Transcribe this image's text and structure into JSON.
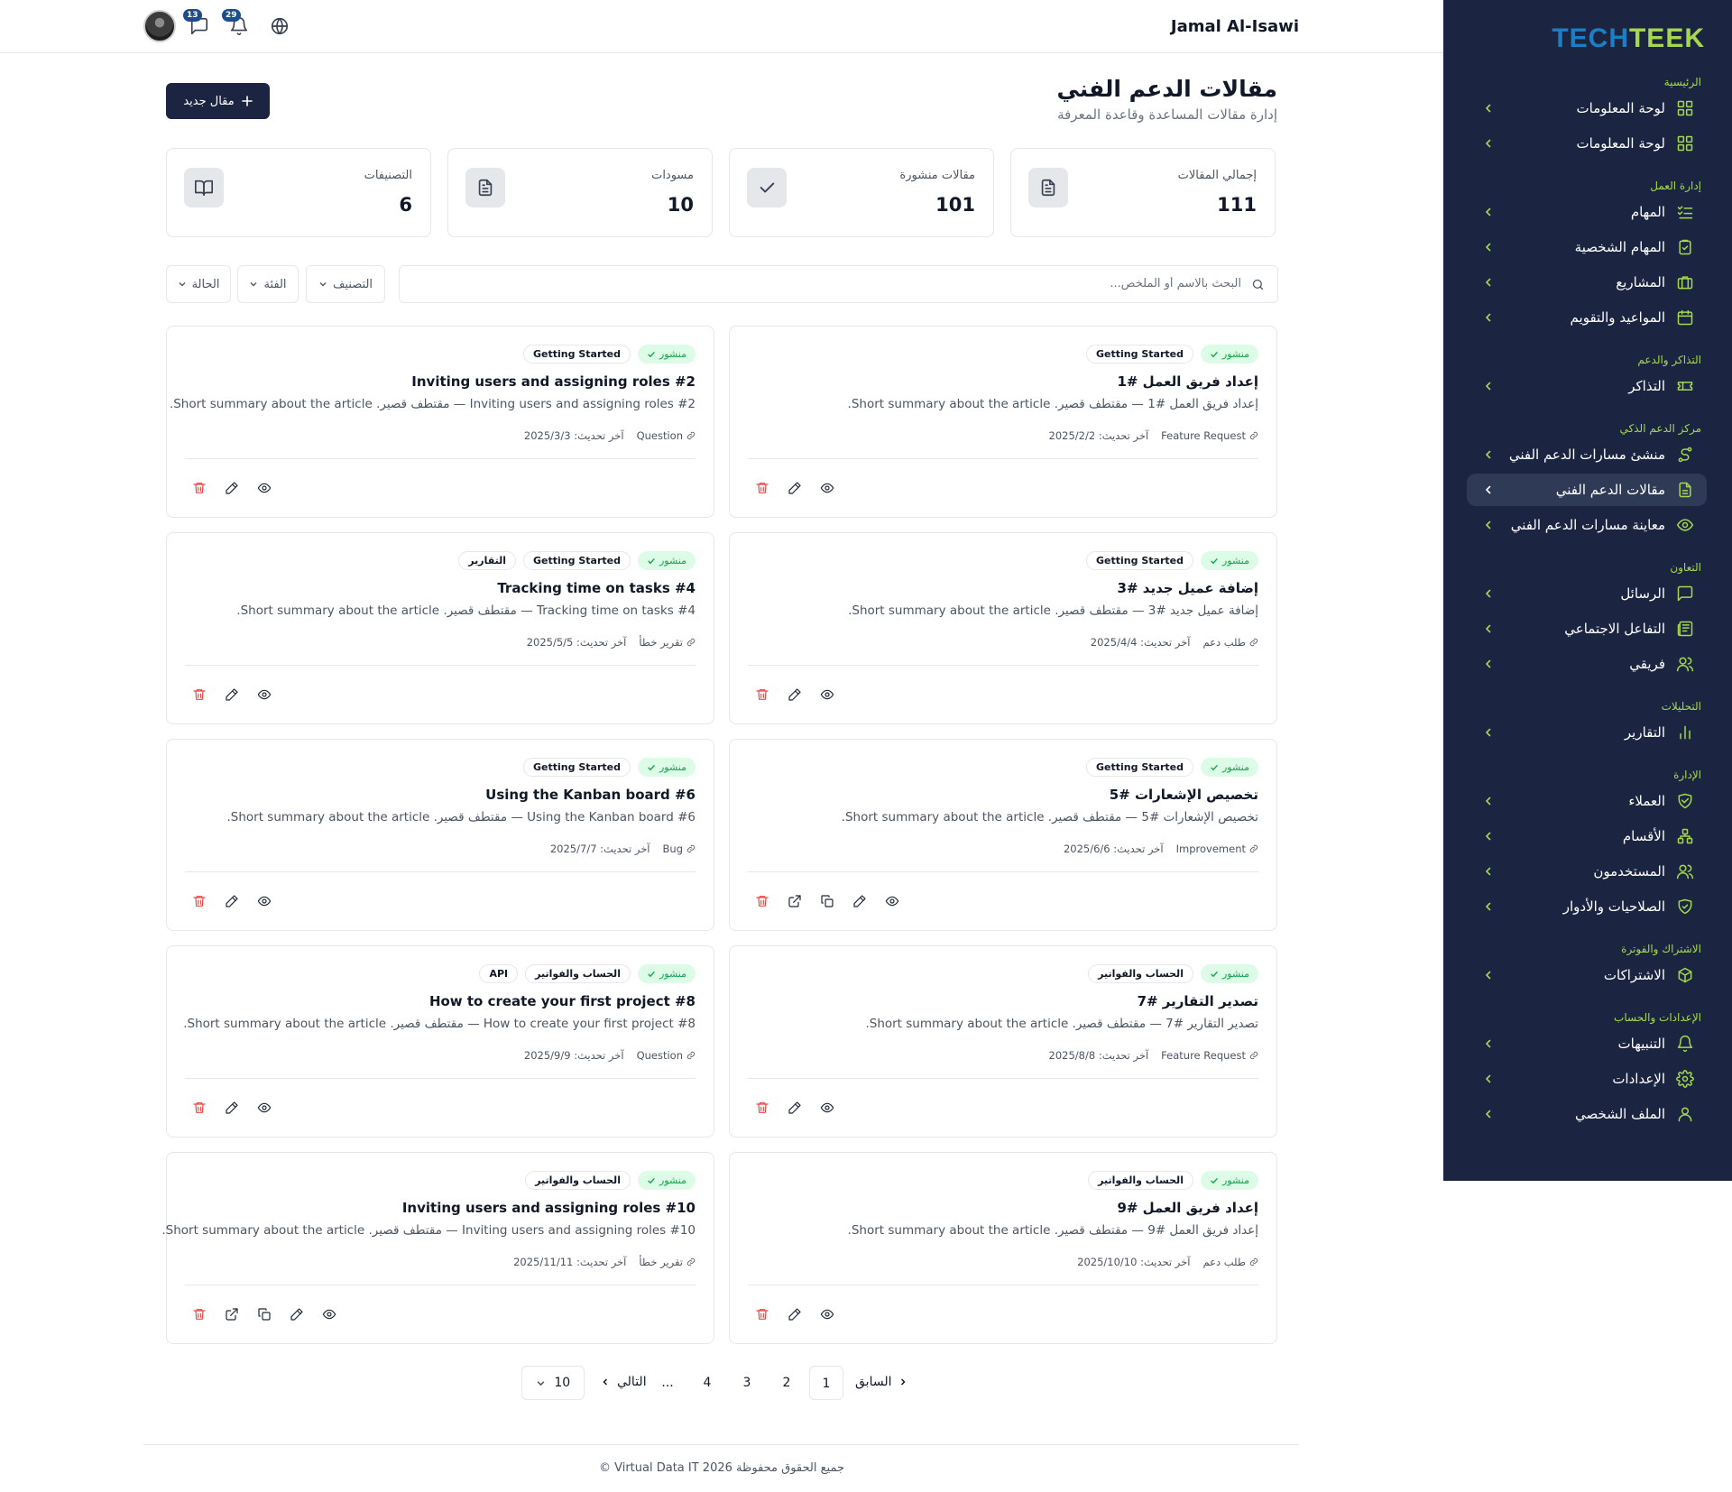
{
  "brand": {
    "part1": "TECH",
    "part2": "TEEK"
  },
  "header": {
    "user_name": "Jamal Al-Isawi",
    "messages_count": "13",
    "notifications_count": "29"
  },
  "sidebar": {
    "sections": [
      {
        "title": "الرئيسية",
        "items": [
          {
            "label": "لوحة المعلومات",
            "icon": "dashboard-icon"
          },
          {
            "label": "لوحة المعلومات",
            "icon": "dashboard-icon"
          }
        ]
      },
      {
        "title": "إدارة العمل",
        "items": [
          {
            "label": "المهام",
            "icon": "list-checks-icon"
          },
          {
            "label": "المهام الشخصية",
            "icon": "clipboard-check-icon"
          },
          {
            "label": "المشاريع",
            "icon": "briefcase-icon"
          },
          {
            "label": "المواعيد والتقويم",
            "icon": "calendar-icon"
          }
        ]
      },
      {
        "title": "التذاكر والدعم",
        "items": [
          {
            "label": "التذاكر",
            "icon": "ticket-icon"
          }
        ]
      },
      {
        "title": "مركز الدعم الذكي",
        "items": [
          {
            "label": "منشئ مسارات الدعم الفني",
            "icon": "route-icon"
          },
          {
            "label": "مقالات الدعم الفني",
            "icon": "document-icon",
            "active": true
          },
          {
            "label": "معاينة مسارات الدعم الفني",
            "icon": "eye-icon"
          }
        ]
      },
      {
        "title": "التعاون",
        "items": [
          {
            "label": "الرسائل",
            "icon": "message-icon"
          },
          {
            "label": "التفاعل الاجتماعي",
            "icon": "newspaper-icon"
          },
          {
            "label": "فريقي",
            "icon": "users-icon"
          }
        ]
      },
      {
        "title": "التحليلات",
        "items": [
          {
            "label": "التقارير",
            "icon": "bar-chart-icon"
          }
        ]
      },
      {
        "title": "الإدارة",
        "items": [
          {
            "label": "العملاء",
            "icon": "handshake-icon"
          },
          {
            "label": "الأقسام",
            "icon": "hierarchy-icon"
          },
          {
            "label": "المستخدمون",
            "icon": "users-icon"
          },
          {
            "label": "الصلاحيات والأدوار",
            "icon": "shield-check-icon"
          }
        ]
      },
      {
        "title": "الاشتراك والفوترة",
        "items": [
          {
            "label": "الاشتراكات",
            "icon": "package-icon"
          }
        ]
      },
      {
        "title": "الإعدادات والحساب",
        "items": [
          {
            "label": "التنبيهات",
            "icon": "bell-icon"
          },
          {
            "label": "الإعدادات",
            "icon": "gear-icon"
          },
          {
            "label": "الملف الشخصي",
            "icon": "user-icon"
          }
        ]
      }
    ]
  },
  "page": {
    "title": "مقالات الدعم الفني",
    "subtitle": "إدارة مقالات المساعدة وقاعدة المعرفة",
    "new_button": "مقال جديد"
  },
  "stats": [
    {
      "label": "إجمالي المقالات",
      "value": "111",
      "icon": "document-icon"
    },
    {
      "label": "مقالات منشورة",
      "value": "101",
      "icon": "check-icon"
    },
    {
      "label": "مسودات",
      "value": "10",
      "icon": "document-icon"
    },
    {
      "label": "التصنيفات",
      "value": "6",
      "icon": "book-open-icon"
    }
  ],
  "filters": {
    "search_placeholder": "البحث بالاسم أو الملخص...",
    "category": "التصنيف",
    "type": "الفئة",
    "status": "الحالة"
  },
  "updated_prefix": "آخر تحديث:",
  "cards": [
    {
      "status": "منشور",
      "tags": [
        "Getting Started"
      ],
      "title": "إعداد فريق العمل #1",
      "summary": "إعداد فريق العمل #1 — مقتطف قصير. Short summary about the article.",
      "type": "Feature Request",
      "updated": "2025/2/2",
      "extra_actions": false
    },
    {
      "status": "منشور",
      "tags": [
        "Getting Started"
      ],
      "title": "Inviting users and assigning roles #2",
      "summary": "Inviting users and assigning roles #2 — مقتطف قصير. Short summary about the article.",
      "type": "Question",
      "updated": "2025/3/3",
      "extra_actions": false
    },
    {
      "status": "منشور",
      "tags": [
        "Getting Started"
      ],
      "title": "إضافة عميل جديد #3",
      "summary": "إضافة عميل جديد #3 — مقتطف قصير. Short summary about the article.",
      "type": "طلب دعم",
      "updated": "2025/4/4",
      "extra_actions": false
    },
    {
      "status": "منشور",
      "tags": [
        "Getting Started",
        "التقارير"
      ],
      "title": "Tracking time on tasks #4",
      "summary": "Tracking time on tasks #4 — مقتطف قصير. Short summary about the article.",
      "type": "تقرير خطأ",
      "updated": "2025/5/5",
      "extra_actions": false
    },
    {
      "status": "منشور",
      "tags": [
        "Getting Started"
      ],
      "title": "تخصيص الإشعارات #5",
      "summary": "تخصيص الإشعارات #5 — مقتطف قصير. Short summary about the article.",
      "type": "Improvement",
      "updated": "2025/6/6",
      "extra_actions": true
    },
    {
      "status": "منشور",
      "tags": [
        "Getting Started"
      ],
      "title": "Using the Kanban board #6",
      "summary": "Using the Kanban board #6 — مقتطف قصير. Short summary about the article.",
      "type": "Bug",
      "updated": "2025/7/7",
      "extra_actions": false
    },
    {
      "status": "منشور",
      "tags": [
        "الحساب والفواتير"
      ],
      "title": "تصدير التقارير #7",
      "summary": "تصدير التقارير #7 — مقتطف قصير. Short summary about the article.",
      "type": "Feature Request",
      "updated": "2025/8/8",
      "extra_actions": false
    },
    {
      "status": "منشور",
      "tags": [
        "الحساب والفواتير",
        "API"
      ],
      "title": "How to create your first project #8",
      "summary": "How to create your first project #8 — مقتطف قصير. Short summary about the article.",
      "type": "Question",
      "updated": "2025/9/9",
      "extra_actions": false
    },
    {
      "status": "منشور",
      "tags": [
        "الحساب والفواتير"
      ],
      "title": "إعداد فريق العمل #9",
      "summary": "إعداد فريق العمل #9 — مقتطف قصير. Short summary about the article.",
      "type": "طلب دعم",
      "updated": "2025/10/10",
      "extra_actions": false
    },
    {
      "status": "منشور",
      "tags": [
        "الحساب والفواتير"
      ],
      "title": "Inviting users and assigning roles #10",
      "summary": "Inviting users and assigning roles #10 — مقتطف قصير. Short summary about the article.",
      "type": "تقرير خطأ",
      "updated": "2025/11/11",
      "extra_actions": true
    }
  ],
  "pagination": {
    "prev": "السابق",
    "next": "التالي",
    "pages": [
      "1",
      "2",
      "3",
      "4",
      "..."
    ],
    "current": "1",
    "page_size": "10"
  },
  "footer": "© Virtual Data IT 2026 جميع الحقوق محفوظة"
}
